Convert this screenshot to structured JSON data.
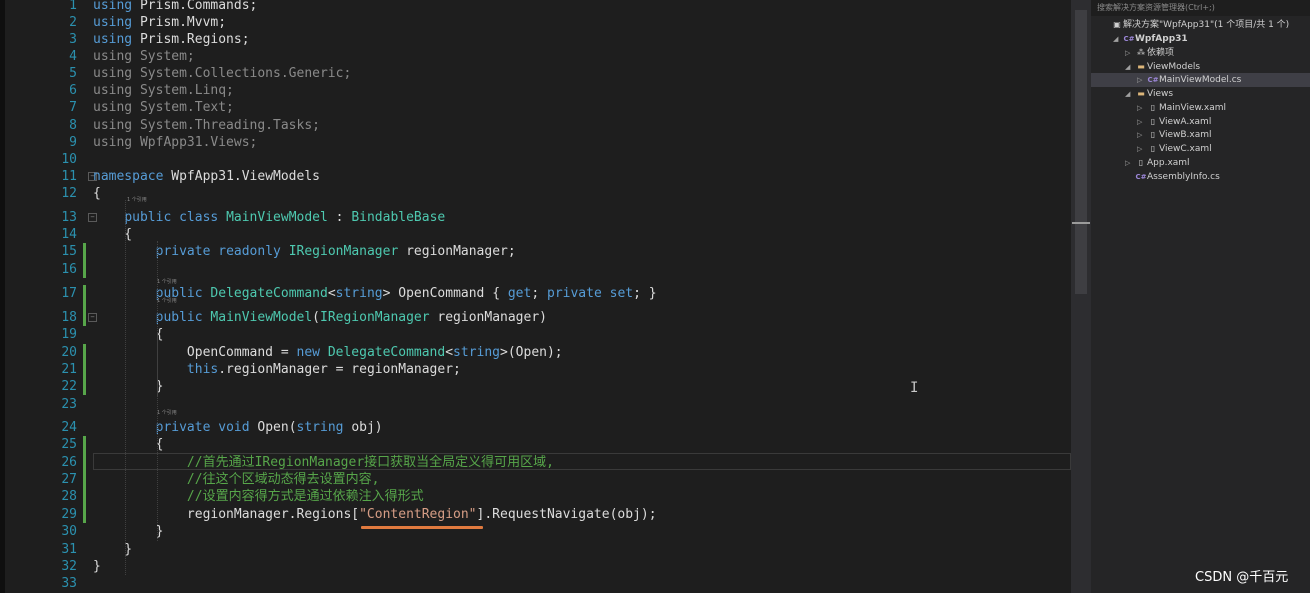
{
  "editor": {
    "codelens": "1 个引用",
    "lines": [
      {
        "n": "1",
        "tokens": [
          {
            "c": "kw",
            "t": "using"
          },
          {
            "t": " Prism.Commands;"
          }
        ]
      },
      {
        "n": "2",
        "tokens": [
          {
            "c": "kw",
            "t": "using"
          },
          {
            "t": " Prism.Mvvm;"
          }
        ]
      },
      {
        "n": "3",
        "tokens": [
          {
            "c": "kw",
            "t": "using"
          },
          {
            "t": " Prism.Regions;"
          }
        ]
      },
      {
        "n": "4",
        "tokens": [
          {
            "c": "dim",
            "t": "using System;"
          }
        ]
      },
      {
        "n": "5",
        "tokens": [
          {
            "c": "dim",
            "t": "using System.Collections.Generic;"
          }
        ]
      },
      {
        "n": "6",
        "tokens": [
          {
            "c": "dim",
            "t": "using System.Linq;"
          }
        ]
      },
      {
        "n": "7",
        "tokens": [
          {
            "c": "dim",
            "t": "using System.Text;"
          }
        ]
      },
      {
        "n": "8",
        "tokens": [
          {
            "c": "dim",
            "t": "using System.Threading.Tasks;"
          }
        ]
      },
      {
        "n": "9",
        "tokens": [
          {
            "c": "dim",
            "t": "using WpfApp31.Views;"
          }
        ]
      },
      {
        "n": "10",
        "tokens": []
      },
      {
        "n": "11",
        "tokens": [
          {
            "c": "kw",
            "t": "namespace"
          },
          {
            "t": " WpfApp31.ViewModels"
          }
        ]
      },
      {
        "n": "12",
        "tokens": [
          {
            "t": "{"
          }
        ]
      },
      {
        "n": "13",
        "tokens": [
          {
            "t": "    "
          },
          {
            "c": "kw",
            "t": "public"
          },
          {
            "t": " "
          },
          {
            "c": "kw",
            "t": "class"
          },
          {
            "t": " "
          },
          {
            "c": "tp",
            "t": "MainViewModel"
          },
          {
            "t": " : "
          },
          {
            "c": "tp",
            "t": "BindableBase"
          }
        ]
      },
      {
        "n": "14",
        "tokens": [
          {
            "t": "    {"
          }
        ]
      },
      {
        "n": "15",
        "tokens": [
          {
            "t": "        "
          },
          {
            "c": "kw",
            "t": "private"
          },
          {
            "t": " "
          },
          {
            "c": "kw",
            "t": "readonly"
          },
          {
            "t": " "
          },
          {
            "c": "tp",
            "t": "IRegionManager"
          },
          {
            "t": " regionManager;"
          }
        ]
      },
      {
        "n": "16",
        "tokens": []
      },
      {
        "n": "17",
        "tokens": [
          {
            "t": "        "
          },
          {
            "c": "kw",
            "t": "public"
          },
          {
            "t": " "
          },
          {
            "c": "tp",
            "t": "DelegateCommand"
          },
          {
            "t": "<"
          },
          {
            "c": "kw",
            "t": "string"
          },
          {
            "t": "> OpenCommand { "
          },
          {
            "c": "kw",
            "t": "get"
          },
          {
            "t": "; "
          },
          {
            "c": "kw",
            "t": "private"
          },
          {
            "t": " "
          },
          {
            "c": "kw",
            "t": "set"
          },
          {
            "t": "; }"
          }
        ]
      },
      {
        "n": "18",
        "tokens": [
          {
            "t": "        "
          },
          {
            "c": "kw",
            "t": "public"
          },
          {
            "t": " "
          },
          {
            "c": "tp",
            "t": "MainViewModel"
          },
          {
            "t": "("
          },
          {
            "c": "tp",
            "t": "IRegionManager"
          },
          {
            "t": " regionManager)"
          }
        ]
      },
      {
        "n": "19",
        "tokens": [
          {
            "t": "        {"
          }
        ]
      },
      {
        "n": "20",
        "tokens": [
          {
            "t": "            OpenCommand = "
          },
          {
            "c": "kw",
            "t": "new"
          },
          {
            "t": " "
          },
          {
            "c": "tp",
            "t": "DelegateCommand"
          },
          {
            "t": "<"
          },
          {
            "c": "kw",
            "t": "string"
          },
          {
            "t": ">(Open);"
          }
        ]
      },
      {
        "n": "21",
        "tokens": [
          {
            "t": "            "
          },
          {
            "c": "kw",
            "t": "this"
          },
          {
            "t": ".regionManager = regionManager;"
          }
        ]
      },
      {
        "n": "22",
        "tokens": [
          {
            "t": "        }"
          }
        ]
      },
      {
        "n": "23",
        "tokens": []
      },
      {
        "n": "24",
        "tokens": [
          {
            "t": "        "
          },
          {
            "c": "kw",
            "t": "private"
          },
          {
            "t": " "
          },
          {
            "c": "kw",
            "t": "void"
          },
          {
            "t": " Open("
          },
          {
            "c": "kw",
            "t": "string"
          },
          {
            "t": " obj)"
          }
        ]
      },
      {
        "n": "25",
        "tokens": [
          {
            "t": "        {"
          }
        ]
      },
      {
        "n": "26",
        "tokens": [
          {
            "t": "            "
          },
          {
            "c": "cm",
            "t": "//首先通过IRegionManager接口获取当全局定义得可用区域,"
          }
        ]
      },
      {
        "n": "27",
        "tokens": [
          {
            "t": "            "
          },
          {
            "c": "cm",
            "t": "//往这个区域动态得去设置内容,"
          }
        ]
      },
      {
        "n": "28",
        "tokens": [
          {
            "t": "            "
          },
          {
            "c": "cm",
            "t": "//设置内容得方式是通过依赖注入得形式"
          }
        ]
      },
      {
        "n": "29",
        "tokens": [
          {
            "t": "            regionManager.Regions["
          },
          {
            "c": "str",
            "t": "\"ContentRegion\""
          },
          {
            "t": "].RequestNavigate(obj);"
          }
        ]
      },
      {
        "n": "30",
        "tokens": [
          {
            "t": "        }"
          }
        ]
      },
      {
        "n": "31",
        "tokens": [
          {
            "t": "    }"
          }
        ]
      },
      {
        "n": "32",
        "tokens": [
          {
            "t": "}"
          }
        ]
      },
      {
        "n": "33",
        "tokens": []
      }
    ]
  },
  "solution_explorer": {
    "search_placeholder": "搜索解决方案资源管理器(Ctrl+;)",
    "items": [
      {
        "label": "解决方案\"WpfApp31\"(1 个项目/共 1 个)",
        "icon": "solution-icon",
        "arrow": "",
        "indent": 0,
        "bold": false,
        "selected": false
      },
      {
        "label": "WpfApp31",
        "icon": "csharp-project-icon",
        "arrow": "◢",
        "indent": 1,
        "bold": true,
        "selected": false
      },
      {
        "label": "依赖项",
        "icon": "dependencies-icon",
        "arrow": "▷",
        "indent": 2,
        "bold": false,
        "selected": false
      },
      {
        "label": "ViewModels",
        "icon": "folder-open-icon",
        "arrow": "◢",
        "indent": 2,
        "bold": false,
        "selected": false
      },
      {
        "label": "MainViewModel.cs",
        "icon": "csharp-file-icon",
        "arrow": "▷",
        "indent": 3,
        "bold": false,
        "selected": true
      },
      {
        "label": "Views",
        "icon": "folder-open-icon",
        "arrow": "◢",
        "indent": 2,
        "bold": false,
        "selected": false
      },
      {
        "label": "MainView.xaml",
        "icon": "xaml-file-icon",
        "arrow": "▷",
        "indent": 3,
        "bold": false,
        "selected": false
      },
      {
        "label": "ViewA.xaml",
        "icon": "xaml-file-icon",
        "arrow": "▷",
        "indent": 3,
        "bold": false,
        "selected": false
      },
      {
        "label": "ViewB.xaml",
        "icon": "xaml-file-icon",
        "arrow": "▷",
        "indent": 3,
        "bold": false,
        "selected": false
      },
      {
        "label": "ViewC.xaml",
        "icon": "xaml-file-icon",
        "arrow": "▷",
        "indent": 3,
        "bold": false,
        "selected": false
      },
      {
        "label": "App.xaml",
        "icon": "xaml-file-icon",
        "arrow": "▷",
        "indent": 2,
        "bold": false,
        "selected": false
      },
      {
        "label": "AssemblyInfo.cs",
        "icon": "csharp-file-icon",
        "arrow": "",
        "indent": 2,
        "bold": false,
        "selected": false
      }
    ]
  },
  "watermark": "CSDN @千百元",
  "colors": {
    "keyword": "#569cd6",
    "type": "#4ec9b0",
    "string": "#d69d85",
    "comment": "#57a64a",
    "line_number": "#2b91af",
    "highlight_underline": "#e07a3f"
  }
}
